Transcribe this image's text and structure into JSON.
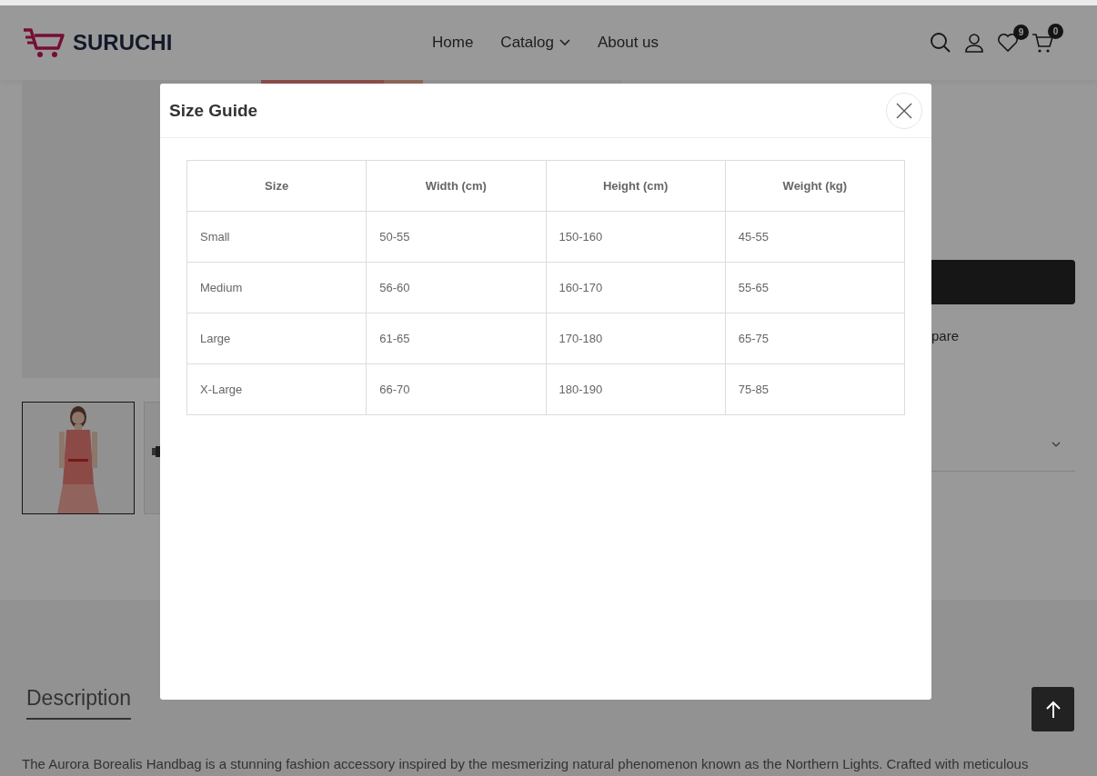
{
  "header": {
    "logo": "SURUCHI",
    "nav": [
      {
        "label": "Home",
        "has_menu": false
      },
      {
        "label": "Catalog",
        "has_menu": true
      },
      {
        "label": "About us",
        "has_menu": false
      }
    ],
    "wishlist_count": "9",
    "cart_count": "0"
  },
  "product": {
    "thumbnails": [
      {
        "selected": true
      },
      {
        "selected": false
      }
    ],
    "compare_link": "pare"
  },
  "modal": {
    "title": "Size Guide",
    "table": {
      "columns": [
        "Size",
        "Width (cm)",
        "Height (cm)",
        "Weight (kg)"
      ],
      "rows": [
        [
          "Small",
          "50-55",
          "150-160",
          "45-55"
        ],
        [
          "Medium",
          "56-60",
          "160-170",
          "55-65"
        ],
        [
          "Large",
          "61-65",
          "170-180",
          "65-75"
        ],
        [
          "X-Large",
          "66-70",
          "180-190",
          "75-85"
        ]
      ]
    }
  },
  "tabs": [
    {
      "label": "Description",
      "selected": true
    }
  ],
  "description": "The Aurora Borealis Handbag is a stunning fashion accessory inspired by the mesmerizing natural phenomenon known as the Northern Lights. Crafted with meticulous"
}
